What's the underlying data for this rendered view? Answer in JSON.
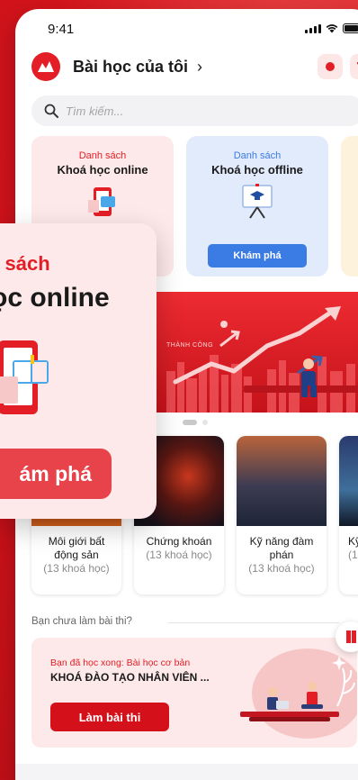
{
  "status_bar": {
    "time": "9:41"
  },
  "header": {
    "title": "Bài học của tôi",
    "chevron": "›"
  },
  "search": {
    "placeholder": "Tìm kiếm..."
  },
  "course_cards": [
    {
      "sub": "Danh sách",
      "main": "Khoá học online"
    },
    {
      "sub": "Danh sách",
      "main": "Khoá học offline",
      "button": "Khám phá"
    }
  ],
  "banner": {
    "slogan": "THÀNH CÔNG"
  },
  "topics": [
    {
      "name": "Môi giới bất động sản",
      "count": "(13 khoá học)"
    },
    {
      "name": "Chứng khoán",
      "count": "(13 khoá học)"
    },
    {
      "name": "Kỹ năng đàm phán",
      "count": "(13 khoá học)"
    },
    {
      "name": "Kỹ",
      "count": "(1"
    }
  ],
  "exam": {
    "section_label": "Bạn chưa làm bài thi?",
    "done_text": "Bạn đã học xong: Bài học cơ bản",
    "course_title": "KHOÁ ĐÀO TẠO NHÂN VIÊN ...",
    "button": "Làm bài thi"
  },
  "overlay_card": {
    "sub": "n sách",
    "main": "ọc online",
    "button": "ám phá"
  },
  "colors": {
    "brand": "#e31e26",
    "blue": "#3b7be4",
    "pink_bg": "#fde9e9",
    "blue_bg": "#e1ebfb",
    "gold_bg": "#fdf3dc"
  },
  "icons": [
    "brand-logo-icon",
    "record-icon",
    "trophy-icon",
    "search-icon",
    "phone-course-icon",
    "presentation-board-icon",
    "book-icon"
  ]
}
